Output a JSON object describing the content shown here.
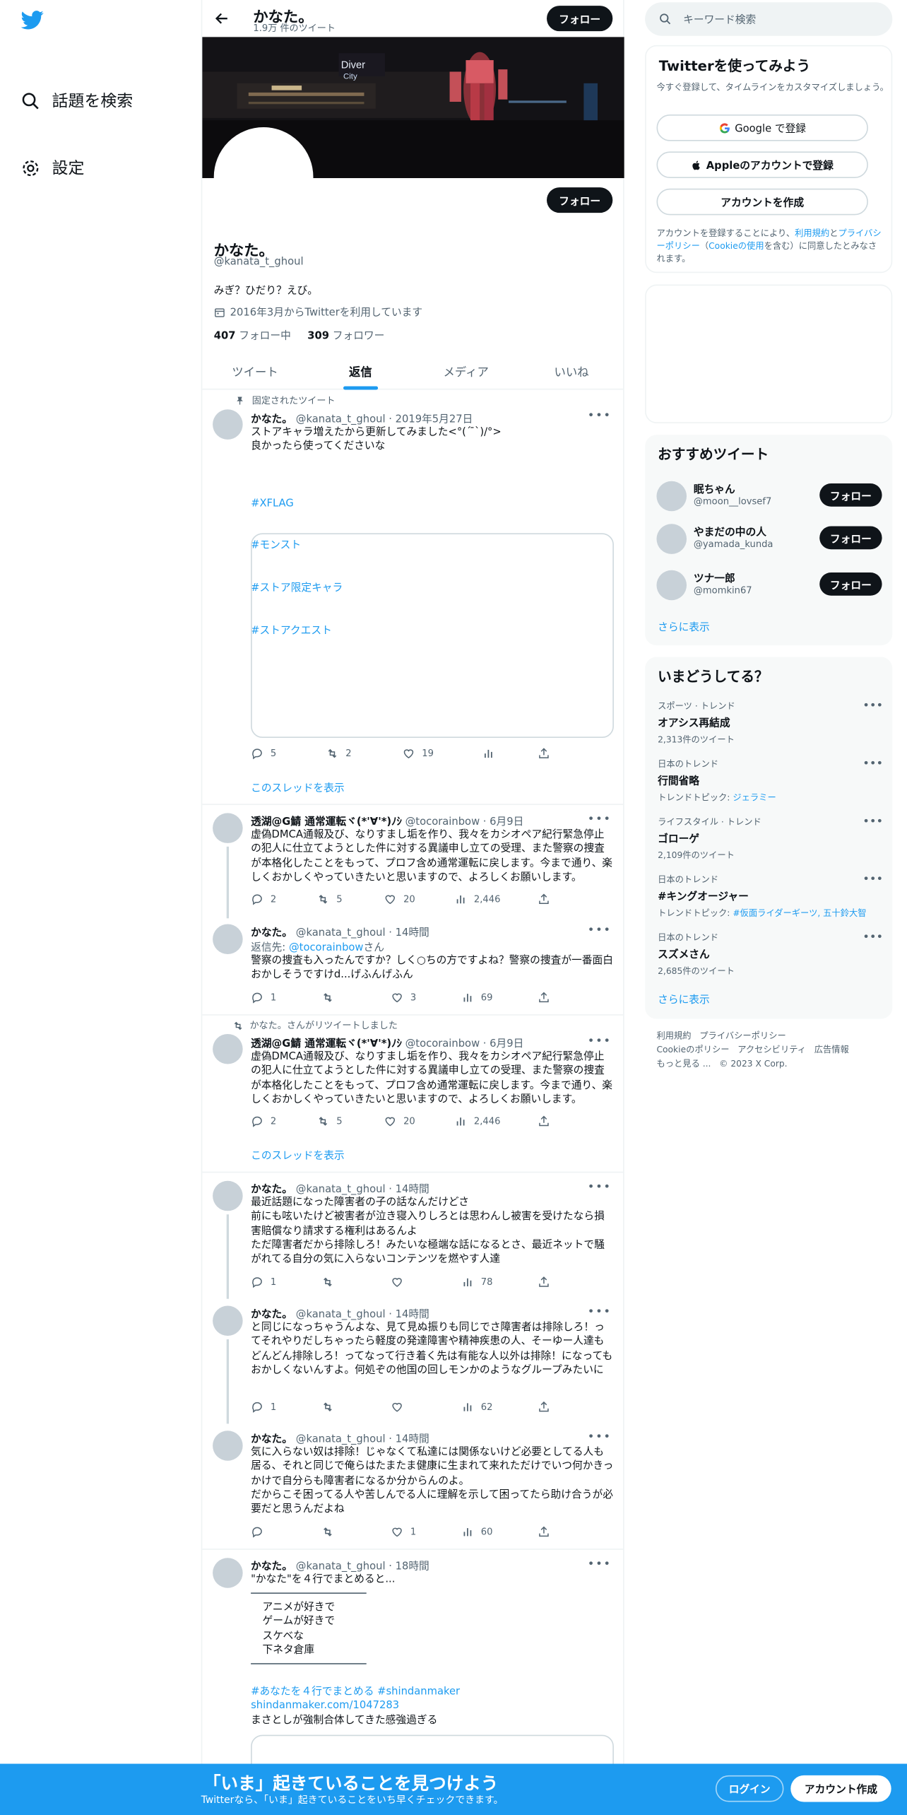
{
  "nav": {
    "explore": "話題を検索",
    "settings": "設定"
  },
  "header": {
    "name": "かなた。",
    "count": "1.9万 件のツイート",
    "follow": "フォロー"
  },
  "profile": {
    "name": "かなた。",
    "handle": "@kanata_t_ghoul",
    "bio": "みぎ？ひだり？えび。",
    "joined": "2016年3月からTwitterを利用しています",
    "following_count": "407",
    "following_label": "フォロー中",
    "followers_count": "309",
    "followers_label": "フォロワー",
    "follow": "フォロー"
  },
  "tabs": [
    "ツイート",
    "返信",
    "メディア",
    "いいね"
  ],
  "pinned": {
    "label": "固定されたツイート",
    "name": "かなた。",
    "meta": "@kanata_t_ghoul · 2019年5月27日",
    "text": "ストアキャラ増えたから更新してみました<°(´ ̄`)/°>\n良かったら使ってくださいな",
    "tags": [
      "#XFLAG",
      "#モンスト",
      "#ストア限定キャラ",
      "#ストアクエスト"
    ],
    "reply": "5",
    "rt": "2",
    "like": "19",
    "thread": "このスレッドを表示"
  },
  "t2": {
    "name": "透湖@G鯖 通常運転ヾ(*'∀'*)ﾉｼ",
    "meta": "@tocorainbow · 6月9日",
    "text": "虚偽DMCA通報及び、なりすまし垢を作り、我々をカシオペア紀行緊急停止の犯人に仕立てようとした件に対する異議申し立ての受理、また警察の捜査が本格化したことをもって、プロフ含め通常運転に戻します。今まで通り、楽しくおかしくやっていきたいと思いますので、よろしくお願いします。",
    "reply": "2",
    "rt": "5",
    "like": "20",
    "views": "2,446"
  },
  "t3": {
    "name": "かなた。",
    "meta": "@kanata_t_ghoul · 14時間",
    "reply_to_label": "返信先: ",
    "reply_to_handle": "@tocorainbow",
    "reply_to_suffix": "さん",
    "text": "警察の捜査も入ったんですか？しく○ちの方ですよね？警察の捜査が一番面白おかしそうですけd...げふんげふん",
    "reply": "1",
    "like": "3",
    "views": "69"
  },
  "t4": {
    "retweeted": "かなた。さんがリツイートしました",
    "name": "透湖@G鯖 通常運転ヾ(*'∀'*)ﾉｼ",
    "meta": "@tocorainbow · 6月9日",
    "text": "虚偽DMCA通報及び、なりすまし垢を作り、我々をカシオペア紀行緊急停止の犯人に仕立てようとした件に対する異議申し立ての受理、また警察の捜査が本格化したことをもって、プロフ含め通常運転に戻します。今まで通り、楽しくおかしくやっていきたいと思いますので、よろしくお願いします。",
    "reply": "2",
    "rt": "5",
    "like": "20",
    "views": "2,446",
    "thread": "このスレッドを表示"
  },
  "t5": {
    "name": "かなた。",
    "meta": "@kanata_t_ghoul · 14時間",
    "text": "最近話題になった障害者の子の話なんだけどさ\n前にも呟いたけど被害者が泣き寝入りしろとは思わんし被害を受けたなら損害賠償なり請求する権利はあるんよ\nただ障害者だから排除しろ！みたいな極端な話になるとさ、最近ネットで騒がれてる自分の気に入らないコンテンツを燃やす人達",
    "reply": "1",
    "views": "78"
  },
  "t6": {
    "name": "かなた。",
    "meta": "@kanata_t_ghoul · 14時間",
    "text": "と同じになっちゃうんよな、見て見ぬ振りも同じでさ障害者は排除しろ！ってそれやりだしちゃったら軽度の発達障害や精神疾患の人、そーゆー人達もどんどん排除しろ！ってなって行き着く先は有能な人以外は排除！になってもおかしくないんすよ。何処ぞの他国の回しモンかのようなグループみたいに",
    "reply": "1",
    "views": "62"
  },
  "t7": {
    "name": "かなた。",
    "meta": "@kanata_t_ghoul · 14時間",
    "text": "気に入らない奴は排除！じゃなくて私達には関係ないけど必要としてる人も居る、それと同じで俺らはたまたま健康に生まれて来れただけでいつ何かきっかけで自分らも障害者になるか分からんのよ。\nだからこそ困ってる人や苦しんでる人に理解を示して困ってたら助け合うが必要だと思うんだよね",
    "like": "1",
    "views": "60"
  },
  "t8": {
    "name": "かなた。",
    "meta": "@kanata_t_ghoul · 18時間",
    "text": "\"かなた\"を４行でまとめると...",
    "lines": [
      "アニメが好きで",
      "ゲームが好きで",
      "スケベな",
      "下ネタ倉庫"
    ],
    "tags": "#あなたを４行でまとめる #shindanmaker",
    "link": "shindanmaker.com/1047283",
    "after": "まさとしが強制合体してきた感強過ぎる"
  },
  "search": {
    "placeholder": "キーワード検索"
  },
  "signup": {
    "title": "Twitterを使ってみよう",
    "sub": "今すぐ登録して、タイムラインをカスタマイズしましょう。",
    "google": "Google で登録",
    "apple": "Appleのアカウントで登録",
    "create": "アカウントを作成",
    "legal_a": "アカウントを登録することにより、",
    "legal_terms": "利用規約",
    "legal_and": "と",
    "legal_privacy": "プライバシーポリシー",
    "legal_b": "（",
    "legal_cookie": "Cookieの使用",
    "legal_c": "を含む）に同意したとみなされます。"
  },
  "recommend": {
    "title": "おすすめツイート",
    "users": [
      {
        "name": "眠ちゃん",
        "handle": "@moon__lovsef7"
      },
      {
        "name": "やまだの中の人",
        "handle": "@yamada_kunda"
      },
      {
        "name": "ツナ一郎",
        "handle": "@momkin67"
      }
    ],
    "follow": "フォロー",
    "more": "さらに表示"
  },
  "trends": {
    "title": "いまどうしてる？",
    "items": [
      {
        "cat": "スポーツ · トレンド",
        "name": "オアシス再結成",
        "sub": "2,313件のツイート",
        "topics": ""
      },
      {
        "cat": "日本のトレンド",
        "name": "行間省略",
        "sub": "トレンドトピック: ",
        "topics": "ジェラミー"
      },
      {
        "cat": "ライフスタイル · トレンド",
        "name": "ゴローゲ",
        "sub": "2,109件のツイート",
        "topics": ""
      },
      {
        "cat": "日本のトレンド",
        "name": "#キングオージャー",
        "sub": "トレンドトピック: ",
        "topics": "#仮面ライダーギーツ, 五十鈴大智"
      },
      {
        "cat": "日本のトレンド",
        "name": "スズメさん",
        "sub": "2,685件のツイート",
        "topics": ""
      }
    ],
    "more": "さらに表示"
  },
  "footer": {
    "l1": "利用規約   プライバシーポリシー",
    "l2": "Cookieのポリシー   アクセシビリティ   広告情報",
    "l3": "もっと見る ...   © 2023 X Corp."
  },
  "bottom": {
    "title": "「いま」起きていることを見つけよう",
    "sub": "Twitterなら、「いま」起きていることをいち早くチェックできます。",
    "login": "ログイン",
    "signup": "アカウント作成"
  }
}
